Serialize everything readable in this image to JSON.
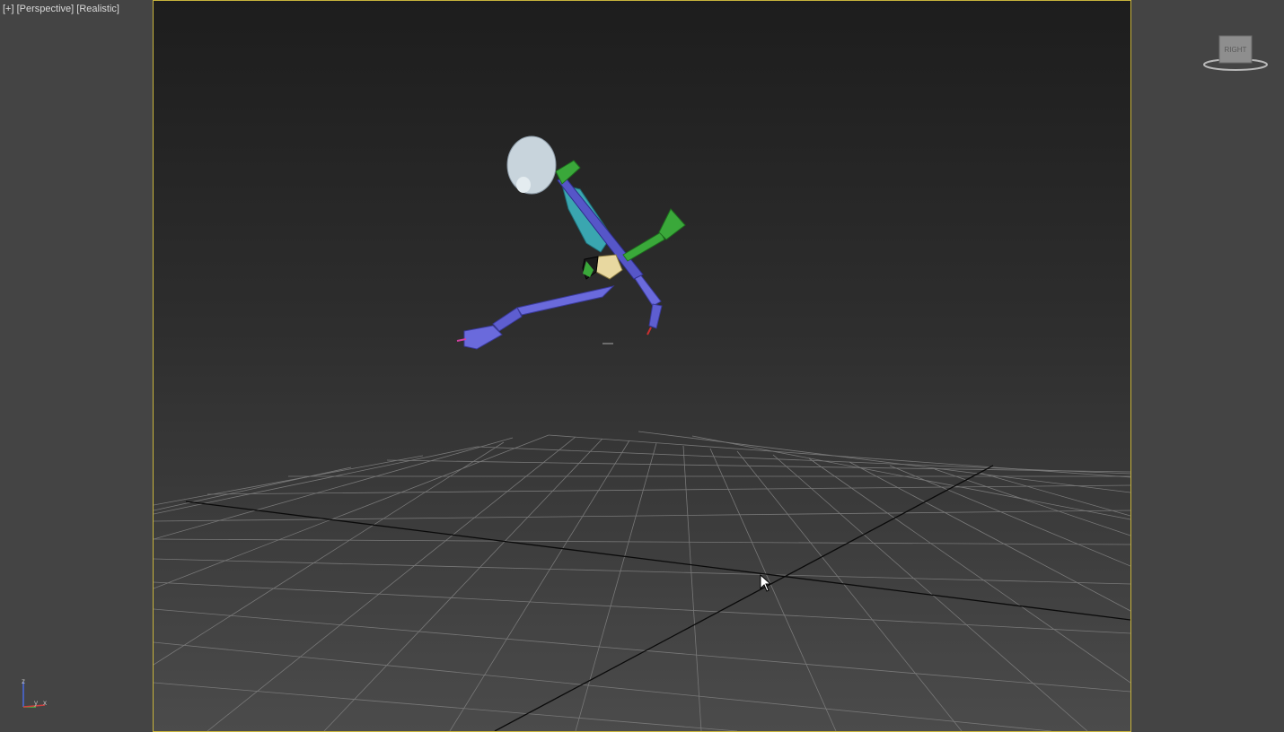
{
  "viewport": {
    "label_plus": "[+]",
    "label_view": "[Perspective]",
    "label_shading": "[Realistic]"
  },
  "viewcube": {
    "face_label": "RIGHT"
  },
  "axis_tripod": {
    "z": "z",
    "y": "y",
    "x": "x"
  },
  "colors": {
    "background": "#444444",
    "viewport_border": "#c8b43c",
    "grid": "#7a7a7a",
    "bone_blue": "#6a6adc",
    "bone_green": "#3aa83a",
    "bone_cyan": "#3aa6b0",
    "skull": "#c8d4dc",
    "pelvis": "#e8d8a0"
  },
  "icons": [
    "viewcube-icon",
    "axis-tripod-icon",
    "mouse-cursor-icon"
  ]
}
